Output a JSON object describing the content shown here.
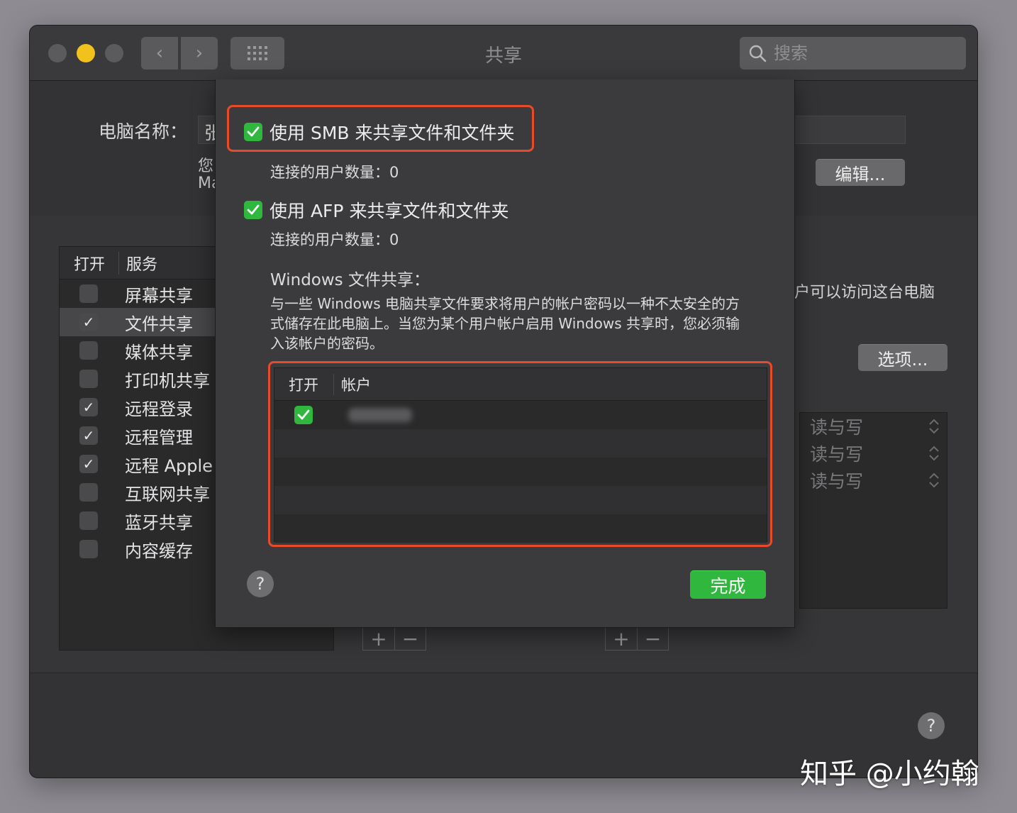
{
  "window": {
    "title": "共享"
  },
  "toolbar": {
    "back": "‹",
    "forward": "›",
    "search_placeholder": "搜索"
  },
  "computer_name": {
    "label": "电脑名称：",
    "value": "张",
    "note_line1": "您",
    "note_line2": "Ma",
    "edit_button": "编辑..."
  },
  "services": {
    "header_on": "打开",
    "header_service": "服务",
    "items": [
      {
        "label": "屏幕共享",
        "checked": false,
        "check": ""
      },
      {
        "label": "文件共享",
        "checked": true,
        "check": "✓"
      },
      {
        "label": "媒体共享",
        "checked": false,
        "check": ""
      },
      {
        "label": "打印机共享",
        "checked": false,
        "check": ""
      },
      {
        "label": "远程登录",
        "checked": true,
        "check": "✓"
      },
      {
        "label": "远程管理",
        "checked": true,
        "check": "✓"
      },
      {
        "label": "远程 Apple 事",
        "checked": true,
        "check": "✓"
      },
      {
        "label": "互联网共享",
        "checked": false,
        "check": ""
      },
      {
        "label": "蓝牙共享",
        "checked": false,
        "check": ""
      },
      {
        "label": "内容缓存",
        "checked": false,
        "check": ""
      }
    ]
  },
  "right_panel": {
    "access_text": "户可以访问这台电脑",
    "options_button": "选项...",
    "permissions": [
      "读与写",
      "读与写",
      "读与写"
    ],
    "plus": "+",
    "minus": "−"
  },
  "sheet": {
    "smb_label": "使用 SMB 来共享文件和文件夹",
    "smb_count": "连接的用户数量：0",
    "afp_label": "使用 AFP 来共享文件和文件夹",
    "afp_count": "连接的用户数量：0",
    "windows_title": "Windows 文件共享：",
    "windows_desc": "与一些 Windows 电脑共享文件要求将用户的帐户密码以一种不太安全的方式储存在此电脑上。当您为某个用户帐户启用 Windows 共享时，您必须输入该帐户的密码。",
    "table_header_on": "打开",
    "table_header_account": "帐户",
    "help": "?",
    "done_button": "完成"
  },
  "help_main": "?",
  "watermark": "知乎 @小约翰",
  "colors": {
    "accent_green": "#2fb83d",
    "highlight_red": "#e84a2c",
    "traffic_yellow": "#f0c21b"
  }
}
